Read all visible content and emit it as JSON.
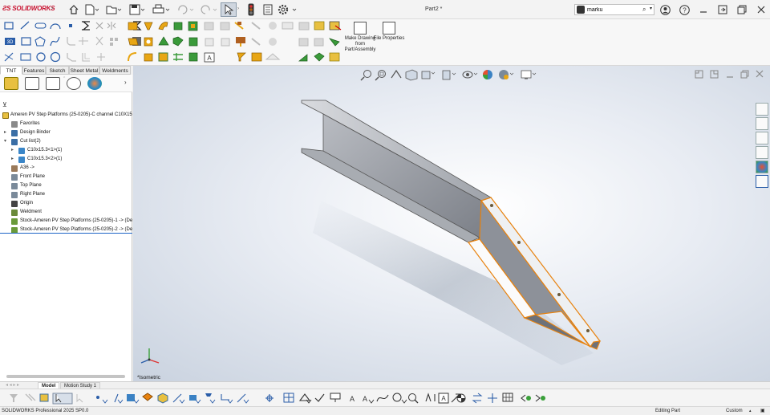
{
  "app": {
    "logo_text": "SOLIDWORKS",
    "doc_title": "Part2 *",
    "search_user": "marku",
    "window_buttons": [
      "minimize",
      "restore-down",
      "close"
    ]
  },
  "command_manager": {
    "big_buttons": [
      {
        "label": "Make Drawing from Part/Assembly"
      },
      {
        "label": "File Properties"
      }
    ],
    "tabs": [
      "TNT",
      "Features",
      "Sketch",
      "Sheet Metal",
      "Weldments"
    ],
    "active_tab": "TNT"
  },
  "feature_tree": {
    "root": "Ameren PV Step Platforms (25-0205)-C channel C10X15.3",
    "items": [
      {
        "label": "Favorites",
        "indent": 1,
        "arrow": "",
        "icon_color": "#8a8a8a"
      },
      {
        "label": "Design Binder",
        "indent": 1,
        "arrow": "▸",
        "icon_color": "#3a6ea5"
      },
      {
        "label": "Cut list(2)",
        "indent": 1,
        "arrow": "▾",
        "icon_color": "#3a6ea5"
      },
      {
        "label": "C10x15.3<1>(1)",
        "indent": 2,
        "arrow": "▸",
        "icon_color": "#3a86c8"
      },
      {
        "label": "C10x15.3<2>(1)",
        "indent": 2,
        "arrow": "▸",
        "icon_color": "#3a86c8"
      },
      {
        "label": "A36 ->",
        "indent": 1,
        "arrow": "",
        "icon_color": "#9a7a5a"
      },
      {
        "label": "Front Plane",
        "indent": 1,
        "arrow": "",
        "icon_color": "#7a8a9a"
      },
      {
        "label": "Top Plane",
        "indent": 1,
        "arrow": "",
        "icon_color": "#7a8a9a"
      },
      {
        "label": "Right Plane",
        "indent": 1,
        "arrow": "",
        "icon_color": "#7a8a9a"
      },
      {
        "label": "Origin",
        "indent": 1,
        "arrow": "",
        "icon_color": "#444444"
      },
      {
        "label": "Weldment",
        "indent": 1,
        "arrow": "",
        "icon_color": "#6a8a3a"
      },
      {
        "label": "Stock-Ameren PV Step Platforms (25-0205)-1 -> (Def",
        "indent": 1,
        "arrow": "",
        "icon_color": "#6a9a3a"
      },
      {
        "label": "Stock-Ameren PV Step Platforms (25-0205)-2 -> (Def",
        "indent": 1,
        "arrow": "",
        "icon_color": "#6a9a3a"
      }
    ]
  },
  "viewport": {
    "view_label": "*Isometric"
  },
  "model_tabs": [
    "Model",
    "Motion Study 1"
  ],
  "active_model_tab": "Model",
  "status": {
    "product": "SOLIDWORKS Professional 2025 SP0.0",
    "mode": "Editing Part",
    "units": "Custom"
  },
  "colors": {
    "accent_red": "#c8102e",
    "selection_orange": "#e8820e",
    "tree_blue": "#3a86c8"
  }
}
